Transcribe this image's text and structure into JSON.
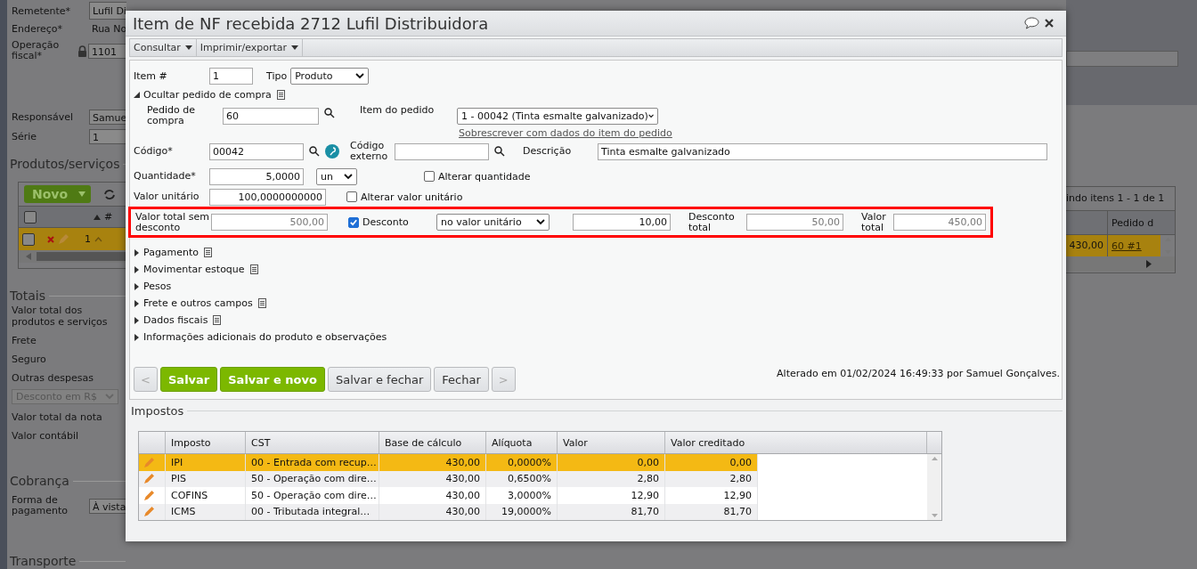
{
  "background": {
    "header_fields": [
      {
        "label": "Remetente*",
        "value": "Lufil Di",
        "kind": "field"
      },
      {
        "label": "Endereço*",
        "value": "Rua No",
        "kind": "plain"
      },
      {
        "label": "Operação fiscal*",
        "value": "1101",
        "kind": "locked"
      }
    ],
    "people_fields": [
      {
        "label": "Responsável",
        "value": "Samue"
      },
      {
        "label": "Série",
        "value": "1"
      }
    ],
    "products": {
      "title": "Produtos/serviços",
      "new_button": "Novo",
      "sort_column": "#",
      "pager": "indo itens 1 - 1 de 1",
      "order_column": "Pedido d",
      "all_checked": false,
      "rows": [
        {
          "number": "1",
          "total": "430,00",
          "order_link": "60 #1",
          "selected": true,
          "checked": false
        }
      ]
    },
    "totals": {
      "title": "Totais",
      "items": [
        {
          "kind": "label",
          "text": "Valor total dos produtos e serviços"
        },
        {
          "kind": "label",
          "text": "Frete"
        },
        {
          "kind": "label",
          "text": "Seguro"
        },
        {
          "kind": "label",
          "text": "Outras despesas"
        },
        {
          "kind": "select",
          "text": "Desconto em R$",
          "disabled": true
        },
        {
          "kind": "label",
          "text": "Valor total da nota"
        },
        {
          "kind": "label",
          "text": "Valor contábil"
        }
      ]
    },
    "billing": {
      "title": "Cobrança",
      "label": "Forma de pagamento",
      "value": "À vista"
    },
    "transport_title": "Transporte"
  },
  "dialog": {
    "title": "Item de NF recebida 2712 Lufil Distribuidora",
    "menu": [
      {
        "label": "Consultar"
      },
      {
        "label": "Imprimir/exportar"
      }
    ],
    "item": {
      "label": "Item #",
      "value": "1"
    },
    "type": {
      "label": "Tipo",
      "value": "Produto"
    },
    "order_toggle": {
      "label": "Ocultar pedido de compra",
      "expanded": true
    },
    "order": {
      "label": "Pedido de compra",
      "value": "60",
      "item_label": "Item do pedido",
      "item_value": "1 - 00042 (Tinta esmalte galvanizado)",
      "overwrite_link": "Sobrescrever com dados do item do pedido"
    },
    "code": {
      "label": "Código*",
      "value": "00042"
    },
    "external_code": {
      "label": "Código externo"
    },
    "description": {
      "label": "Descrição",
      "value": "Tinta esmalte galvanizado"
    },
    "quantity": {
      "label": "Quantidade*",
      "value": "5,0000",
      "unit": "un",
      "change_label": "Alterar quantidade",
      "change_checked": false
    },
    "unit_price": {
      "label": "Valor unitário",
      "value": "100,0000000000",
      "change_label": "Alterar valor unitário",
      "change_checked": false
    },
    "discount": {
      "highlighted": true,
      "gross_label": "Valor total sem desconto",
      "gross_value": "500,00",
      "enabled_label": "Desconto",
      "enabled": true,
      "mode": "no valor unitário",
      "amount": "10,00",
      "total_label": "Desconto total",
      "total_value": "50,00",
      "net_label": "Valor total",
      "net_value": "450,00"
    },
    "sections": [
      {
        "label": "Pagamento",
        "expanded": false,
        "notes": true
      },
      {
        "label": "Movimentar estoque",
        "expanded": false,
        "notes": true
      },
      {
        "label": "Pesos",
        "expanded": false,
        "notes": false
      },
      {
        "label": "Frete e outros campos",
        "expanded": false,
        "notes": true
      },
      {
        "label": "Dados fiscais",
        "expanded": false,
        "notes": true
      },
      {
        "label": "Informações adicionais do produto e observações",
        "expanded": false,
        "notes": false
      }
    ],
    "buttons": [
      {
        "label": "<",
        "kind": "nav",
        "disabled": true
      },
      {
        "label": "Salvar",
        "kind": "primary",
        "disabled": false
      },
      {
        "label": "Salvar e novo",
        "kind": "primary",
        "disabled": false
      },
      {
        "label": "Salvar e fechar",
        "kind": "secondary",
        "disabled": false
      },
      {
        "label": "Fechar",
        "kind": "secondary",
        "disabled": false
      },
      {
        "label": ">",
        "kind": "nav",
        "disabled": true
      }
    ],
    "changed_note": "Alterado em 01/02/2024 16:49:33 por Samuel Gonçalves.",
    "taxes": {
      "title": "Impostos",
      "columns": [
        "Imposto",
        "CST",
        "Base de cálculo",
        "Alíquota",
        "Valor",
        "Valor creditado"
      ],
      "rows": [
        {
          "tax": "IPI",
          "cst": "00 - Entrada com recup…",
          "base": "430,00",
          "rate": "0,0000%",
          "value": "0,00",
          "credited": "0,00",
          "selected": true
        },
        {
          "tax": "PIS",
          "cst": "50 - Operação com dire…",
          "base": "430,00",
          "rate": "0,6500%",
          "value": "2,80",
          "credited": "2,80",
          "selected": false
        },
        {
          "tax": "COFINS",
          "cst": "50 - Operação com dire…",
          "base": "430,00",
          "rate": "3,0000%",
          "value": "12,90",
          "credited": "12,90",
          "selected": false
        },
        {
          "tax": "ICMS",
          "cst": "00 - Tributada integral…",
          "base": "430,00",
          "rate": "19,0000%",
          "value": "81,70",
          "credited": "81,70",
          "selected": false
        }
      ]
    }
  }
}
